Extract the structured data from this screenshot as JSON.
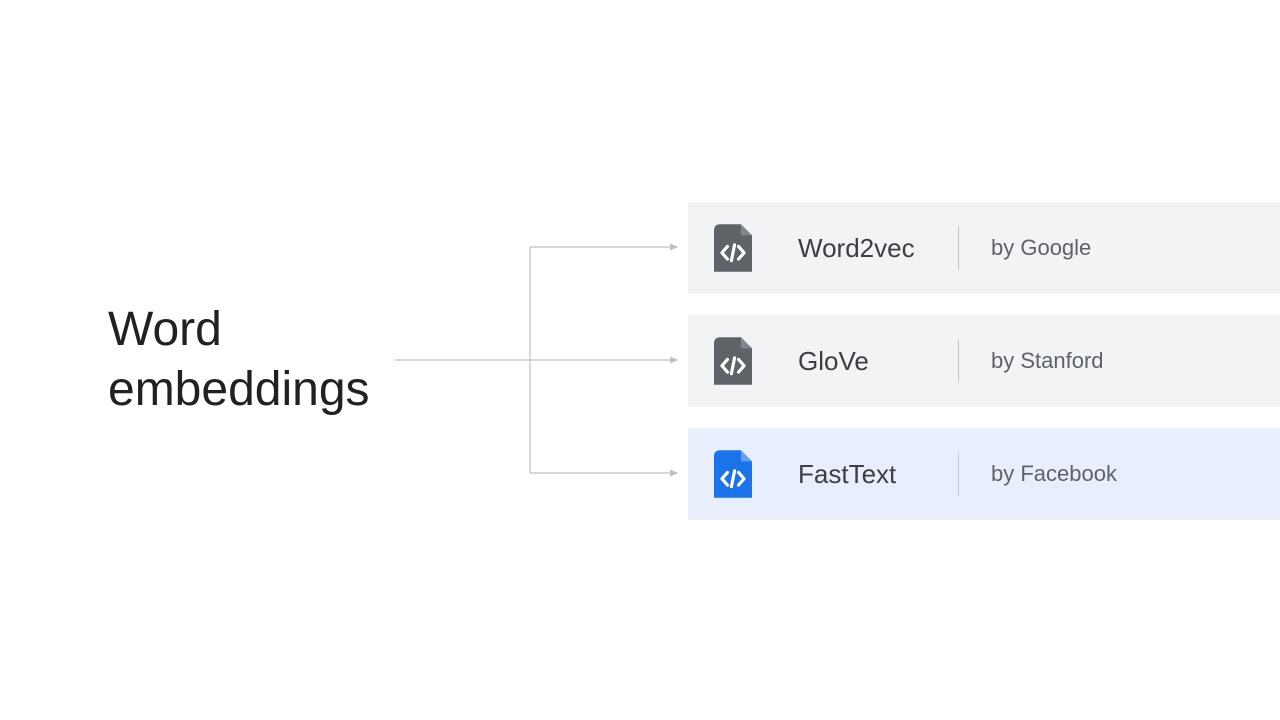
{
  "title_line1": "Word",
  "title_line2": "embeddings",
  "items": [
    {
      "name": "Word2vec",
      "by": "by Google",
      "highlighted": false,
      "icon_color": "#5f6368"
    },
    {
      "name": "GloVe",
      "by": "by Stanford",
      "highlighted": false,
      "icon_color": "#5f6368"
    },
    {
      "name": "FastText",
      "by": "by Facebook",
      "highlighted": true,
      "icon_color": "#1a73e8"
    }
  ]
}
